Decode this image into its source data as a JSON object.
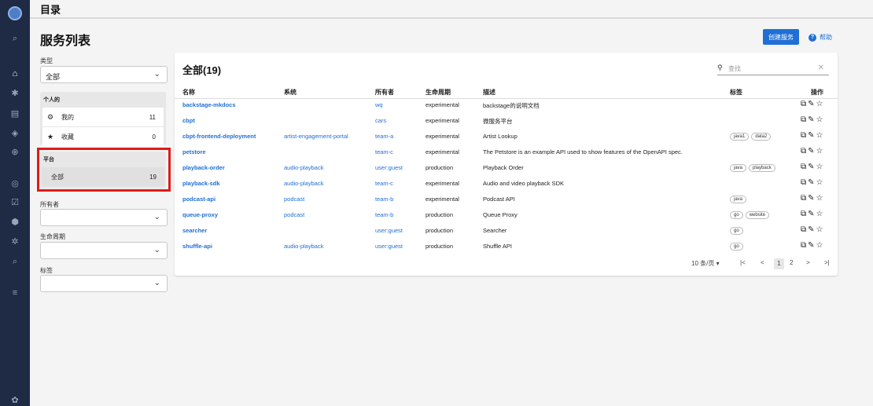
{
  "header": {
    "title": "目录"
  },
  "page": {
    "title": "服务列表",
    "create_label": "创建服务",
    "help_label": "帮助"
  },
  "nav": {
    "icons": [
      "logo-icon",
      "search-icon",
      "home-icon",
      "puzzle-icon",
      "docs-icon",
      "layers-icon",
      "plus-circle-icon",
      "target-icon",
      "checkbox-icon",
      "shield-icon",
      "gear-alt-icon",
      "search-alt-icon",
      "menu-icon",
      "settings-icon"
    ],
    "glyphs": [
      "",
      "⌕",
      "⌂",
      "✱",
      "▤",
      "◈",
      "⊕",
      "◎",
      "☑",
      "⬢",
      "✲",
      "⌕",
      "≡",
      "✿"
    ]
  },
  "filters": {
    "type_label": "类型",
    "type_value": "全部",
    "personal_header": "个人的",
    "personal_items": [
      {
        "label": "我的",
        "count": "11",
        "icon": "⚙"
      },
      {
        "label": "收藏",
        "count": "0",
        "icon": "★"
      }
    ],
    "platform_header": "平台",
    "platform_item": {
      "label": "全部",
      "count": "19"
    },
    "owner_label": "所有者",
    "owner_value": "",
    "lifecycle_label": "生命周期",
    "lifecycle_value": "",
    "tags_label": "标签",
    "tags_value": ""
  },
  "table": {
    "title": "全部(19)",
    "search_placeholder": "查找",
    "columns": [
      "名称",
      "系统",
      "所有者",
      "生命周期",
      "描述",
      "标签",
      "操作"
    ],
    "rows": [
      {
        "name": "backstage-mkdocs",
        "system": "",
        "owner": "wq",
        "lifecycle": "experimental",
        "desc": "backstage的说明文档",
        "tags": []
      },
      {
        "name": "cbpt",
        "system": "",
        "owner": "cars",
        "lifecycle": "experimental",
        "desc": "微服务平台",
        "tags": []
      },
      {
        "name": "cbpt-frontend-deployment",
        "system": "artist-engagement-portal",
        "owner": "team-a",
        "lifecycle": "experimental",
        "desc": "Artist Lookup",
        "tags": [
          "java1",
          "data2"
        ]
      },
      {
        "name": "petstore",
        "system": "",
        "owner": "team-c",
        "lifecycle": "experimental",
        "desc": "The Petstore is an example API used to show features of the OpenAPI spec.",
        "tags": []
      },
      {
        "name": "playback-order",
        "system": "audio-playback",
        "owner": "user:guest",
        "lifecycle": "production",
        "desc": "Playback Order",
        "tags": [
          "java",
          "playback"
        ]
      },
      {
        "name": "playback-sdk",
        "system": "audio-playback",
        "owner": "team-c",
        "lifecycle": "experimental",
        "desc": "Audio and video playback SDK",
        "tags": []
      },
      {
        "name": "podcast-api",
        "system": "podcast",
        "owner": "team-b",
        "lifecycle": "experimental",
        "desc": "Podcast API",
        "tags": [
          "java"
        ]
      },
      {
        "name": "queue-proxy",
        "system": "podcast",
        "owner": "team-b",
        "lifecycle": "production",
        "desc": "Queue Proxy",
        "tags": [
          "go",
          "website"
        ]
      },
      {
        "name": "searcher",
        "system": "",
        "owner": "user:guest",
        "lifecycle": "production",
        "desc": "Searcher",
        "tags": [
          "go"
        ]
      },
      {
        "name": "shuffle-api",
        "system": "audio-playback",
        "owner": "user:guest",
        "lifecycle": "production",
        "desc": "Shuffle API",
        "tags": [
          "go"
        ]
      }
    ],
    "pagination": {
      "per_page": "10 条/页",
      "pages": [
        "1",
        "2"
      ],
      "current": "1"
    }
  },
  "colors": {
    "accent": "#1f6fd6",
    "nav_bg": "#1f2a44",
    "highlight": "#e01b1b"
  }
}
